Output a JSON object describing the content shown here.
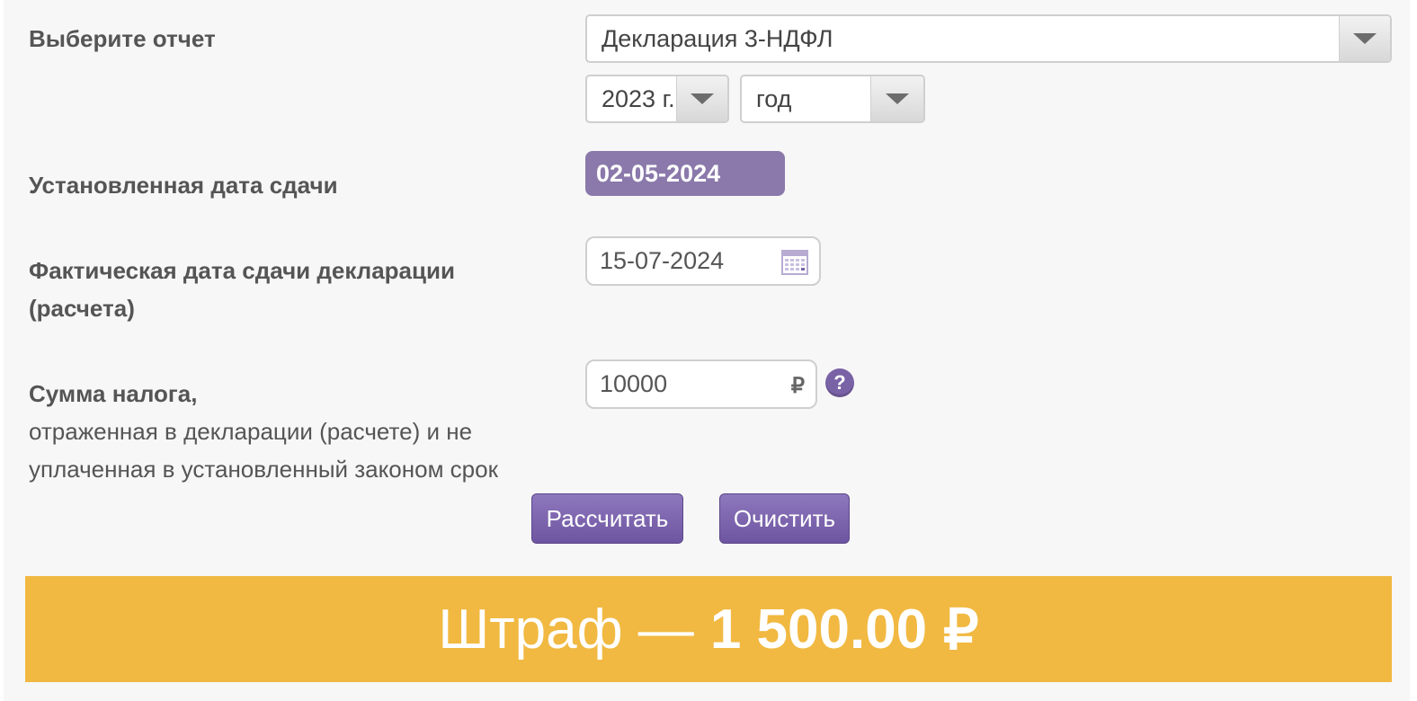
{
  "form": {
    "report_label": "Выберите отчет",
    "report_value": "Декларация 3-НДФЛ",
    "year_value": "2023 г.",
    "period_value": "год",
    "due_label": "Установленная дата сдачи",
    "due_date": "02-05-2024",
    "actual_label_line1": "Фактическая дата сдачи декларации",
    "actual_label_line2": "(расчета)",
    "actual_date": "15-07-2024",
    "tax_label_bold": "Сумма налога,",
    "tax_label_line2": "отраженная в декларации (расчете) и не",
    "tax_label_line3": "уплаченная в установленный законом срок",
    "tax_value": "10000",
    "currency_symbol": "₽",
    "help_symbol": "?"
  },
  "buttons": {
    "calculate": "Рассчитать",
    "clear": "Очистить"
  },
  "result": {
    "prefix": "Штраф —",
    "amount": "1 500.00",
    "currency": "₽"
  },
  "colors": {
    "accent_purple": "#7a62a6",
    "due_badge": "#8a79aa",
    "result_bar": "#f1b942"
  },
  "icons": {
    "dropdown": "chevron-down-icon",
    "calendar": "calendar-icon",
    "currency": "ruble-icon",
    "help": "question-icon"
  }
}
